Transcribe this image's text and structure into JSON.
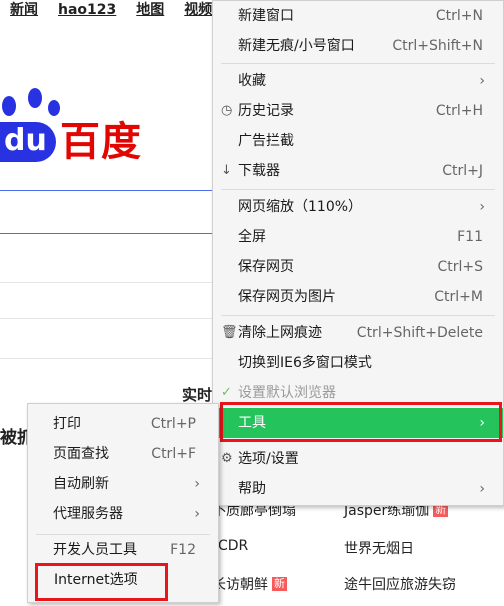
{
  "background": {
    "nav": [
      "新闻",
      "hao123",
      "地图",
      "视频"
    ],
    "logo_text": "百度",
    "logo_du": "du",
    "side_label_1": "实时",
    "side_label_2": "被抓",
    "news": [
      {
        "left": "不质廊亭倒塌",
        "right": "Jasper练瑜伽",
        "right_badge": "新"
      },
      {
        "left": "CDR",
        "right": "世界无烟日"
      },
      {
        "left": "长访朝鲜",
        "left_badge": "新",
        "right": "途牛回应旅游失窃"
      }
    ]
  },
  "main_menu": {
    "new_window": {
      "label": "新建窗口",
      "shortcut": "Ctrl+N"
    },
    "new_private": {
      "label": "新建无痕/小号窗口",
      "shortcut": "Ctrl+Shift+N"
    },
    "favorites": {
      "label": "收藏",
      "arrow": "›"
    },
    "history": {
      "label": "历史记录",
      "shortcut": "Ctrl+H",
      "icon": "clock-icon"
    },
    "adblock": {
      "label": "广告拦截"
    },
    "downloads": {
      "label": "下载器",
      "shortcut": "Ctrl+J",
      "icon": "download-arrow-icon"
    },
    "zoom": {
      "label": "网页缩放（110%）",
      "arrow": "›"
    },
    "fullscreen": {
      "label": "全屏",
      "shortcut": "F11"
    },
    "save_page": {
      "label": "保存网页",
      "shortcut": "Ctrl+S"
    },
    "save_image": {
      "label": "保存网页为图片",
      "shortcut": "Ctrl+M"
    },
    "clear_traces": {
      "label": "清除上网痕迹",
      "shortcut": "Ctrl+Shift+Delete",
      "icon": "trash-icon"
    },
    "ie6_mode": {
      "label": "切换到IE6多窗口模式"
    },
    "default_browser": {
      "label": "设置默认浏览器",
      "icon": "check-icon"
    },
    "tools": {
      "label": "工具",
      "arrow": "›"
    },
    "options": {
      "label": "选项/设置",
      "icon": "gear-icon"
    },
    "help": {
      "label": "帮助",
      "arrow": "›"
    }
  },
  "sub_menu": {
    "print": {
      "label": "打印",
      "shortcut": "Ctrl+P"
    },
    "find": {
      "label": "页面查找",
      "shortcut": "Ctrl+F"
    },
    "auto_refresh": {
      "label": "自动刷新",
      "arrow": "›"
    },
    "proxy": {
      "label": "代理服务器",
      "arrow": "›"
    },
    "devtools": {
      "label": "开发人员工具",
      "shortcut": "F12"
    },
    "internet_options": {
      "label": "Internet选项"
    }
  },
  "colors": {
    "highlight": "#24c35c",
    "annotation": "#e8151b",
    "baidu_blue": "#2932e1",
    "baidu_red": "#e10602"
  }
}
